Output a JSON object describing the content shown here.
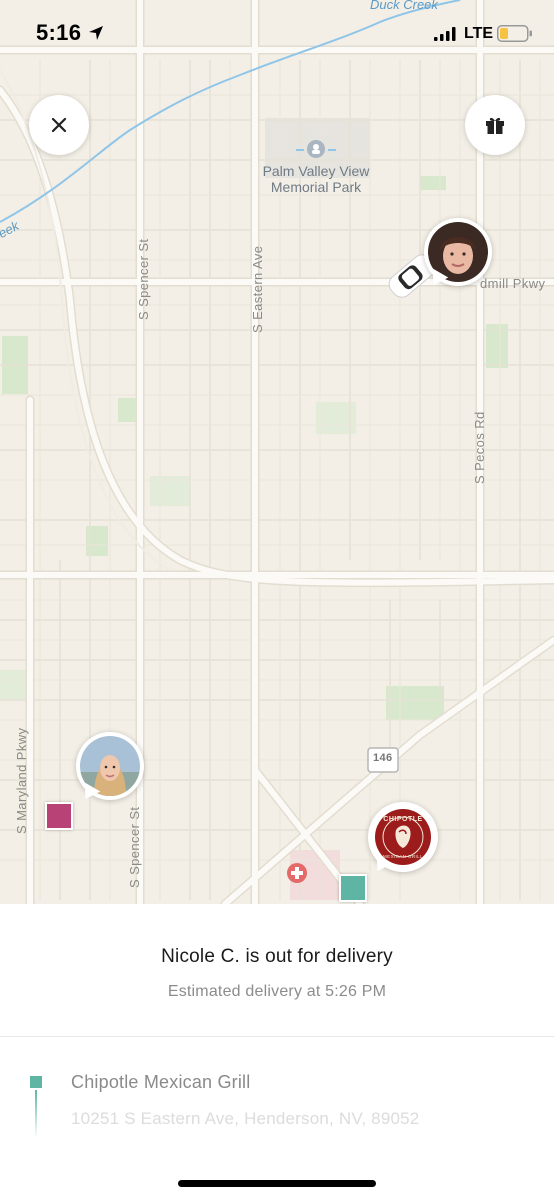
{
  "status_bar": {
    "time": "5:16",
    "carrier": "LTE",
    "icons": [
      "location-arrow-icon",
      "signal-bars-icon",
      "battery-icon"
    ],
    "battery_color": "#f5c242"
  },
  "map": {
    "park_name": "Palm Valley View\nMemorial Park",
    "creek_top": "Duck Creek",
    "creek_left": "eek",
    "streets": {
      "spencer_top": "S Spencer St",
      "eastern": "S Eastern Ave",
      "windmill": "dmill Pkwy",
      "pecos": "S Pecos Rd",
      "maryland": "S Maryland Pkwy",
      "spencer_bottom": "S Spencer St"
    },
    "route_shield": "146",
    "close_icon": "close-icon",
    "gift_icon": "gift-icon",
    "logo_text_top": "CHIPOTLE",
    "logo_text_bottom": "MEXICAN GRILL"
  },
  "colors": {
    "map_background": "#f3efe6",
    "road_major": "#fbfaf7",
    "water": "#8ec5e8",
    "park_green": "#d8e8cc",
    "home_marker": "#b84276",
    "restaurant_marker": "#5fb5a4",
    "brand_red": "#9c1c1c"
  },
  "sheet": {
    "title": "Nicole C. is out for delivery",
    "eta": "Estimated delivery at 5:26 PM",
    "restaurant_name": "Chipotle Mexican Grill",
    "restaurant_address": "10251 S Eastern Ave, Henderson, NV, 89052"
  }
}
